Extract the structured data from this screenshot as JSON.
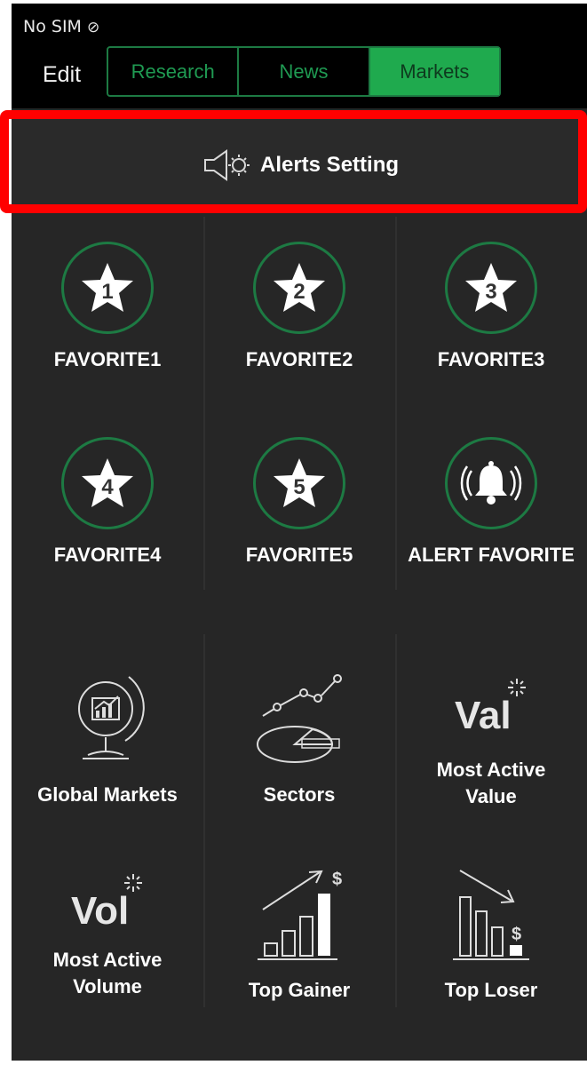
{
  "status": {
    "carrier": "No SIM"
  },
  "header": {
    "edit_label": "Edit",
    "tabs": [
      {
        "label": "Research",
        "active": false
      },
      {
        "label": "News",
        "active": false
      },
      {
        "label": "Markets",
        "active": true
      }
    ]
  },
  "alerts_setting": {
    "label": "Alerts Setting"
  },
  "favorites": [
    {
      "label": "FAVORITE1",
      "number": "1"
    },
    {
      "label": "FAVORITE2",
      "number": "2"
    },
    {
      "label": "FAVORITE3",
      "number": "3"
    },
    {
      "label": "FAVORITE4",
      "number": "4"
    },
    {
      "label": "FAVORITE5",
      "number": "5"
    },
    {
      "label": "ALERT FAVORITE"
    }
  ],
  "markets": [
    {
      "label": "Global Markets"
    },
    {
      "label": "Sectors"
    },
    {
      "label_line1": "Most Active",
      "label_line2": "Value",
      "icon_text": "Val"
    },
    {
      "label_line1": "Most Active",
      "label_line2": "Volume",
      "icon_text": "Vol"
    },
    {
      "label": "Top Gainer"
    },
    {
      "label": "Top Loser"
    }
  ],
  "colors": {
    "accent": "#1faa4e",
    "border": "#1d7a43",
    "background": "#262626",
    "highlight": "#ff0000"
  }
}
